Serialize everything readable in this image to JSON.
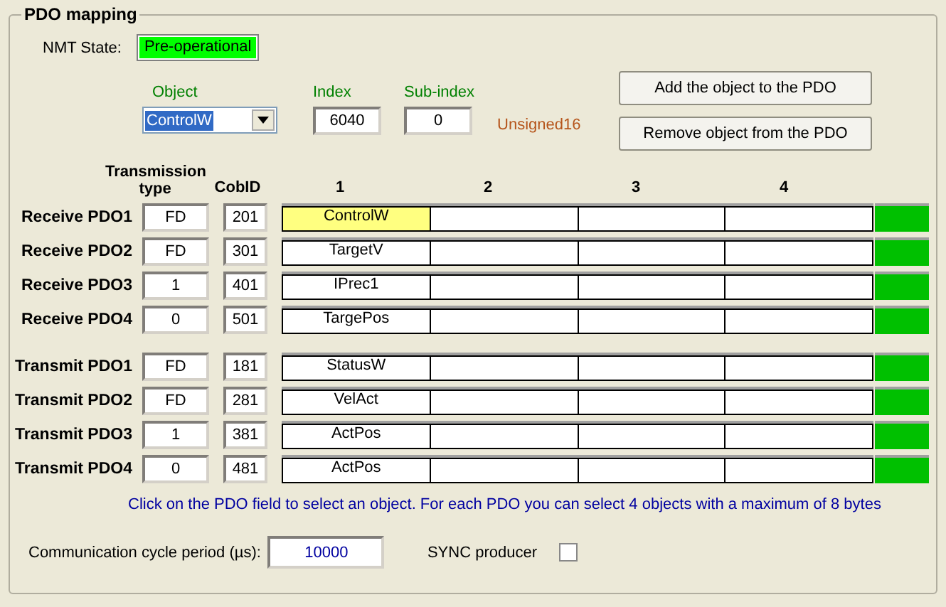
{
  "group_title": "PDO mapping",
  "nmt": {
    "label": "NMT State:",
    "value": "Pre-operational",
    "color": "#00ff00"
  },
  "object": {
    "label": "Object",
    "value": "ControlW"
  },
  "index": {
    "label": "Index",
    "value": "6040"
  },
  "subindex": {
    "label": "Sub-index",
    "value": "0"
  },
  "data_type": "Unsigned16",
  "buttons": [
    "Add the object to the PDO",
    "Remove object from the PDO"
  ],
  "columns": {
    "transmission_type": "Transmission type",
    "cobid": "CobID",
    "objects": [
      "1",
      "2",
      "3",
      "4"
    ]
  },
  "groups": [
    {
      "rows": [
        {
          "label": "Receive PDO1",
          "transmission_type": "FD",
          "cobid": "201",
          "color": "#00c000",
          "objects": [
            {
              "name": "ControlW",
              "selected": true
            }
          ]
        },
        {
          "label": "Receive PDO2",
          "transmission_type": "FD",
          "cobid": "301",
          "color": "#00c000",
          "objects": [
            {
              "name": "TargetV",
              "selected": false
            }
          ]
        },
        {
          "label": "Receive PDO3",
          "transmission_type": "1",
          "cobid": "401",
          "color": "#00c000",
          "objects": [
            {
              "name": "IPrec1",
              "selected": false
            }
          ]
        },
        {
          "label": "Receive PDO4",
          "transmission_type": "0",
          "cobid": "501",
          "color": "#00c000",
          "objects": [
            {
              "name": "TargePos",
              "selected": false
            }
          ]
        }
      ]
    },
    {
      "rows": [
        {
          "label": "Transmit PDO1",
          "transmission_type": "FD",
          "cobid": "181",
          "color": "#00c000",
          "objects": [
            {
              "name": "StatusW",
              "selected": false
            }
          ]
        },
        {
          "label": "Transmit PDO2",
          "transmission_type": "FD",
          "cobid": "281",
          "color": "#00c000",
          "objects": [
            {
              "name": "VelAct",
              "selected": false
            }
          ]
        },
        {
          "label": "Transmit PDO3",
          "transmission_type": "1",
          "cobid": "381",
          "color": "#00c000",
          "objects": [
            {
              "name": "ActPos",
              "selected": false
            }
          ]
        },
        {
          "label": "Transmit PDO4",
          "transmission_type": "0",
          "cobid": "481",
          "color": "#00c000",
          "objects": [
            {
              "name": "ActPos",
              "selected": false
            }
          ]
        }
      ]
    }
  ],
  "hint": "Click on the PDO field to select an object. For each PDO you can select 4 objects with a maximum of 8 bytes",
  "cycle": {
    "label": "Communication cycle period (µs):",
    "value": "10000"
  },
  "sync": {
    "label": "SYNC producer",
    "checked": false
  }
}
